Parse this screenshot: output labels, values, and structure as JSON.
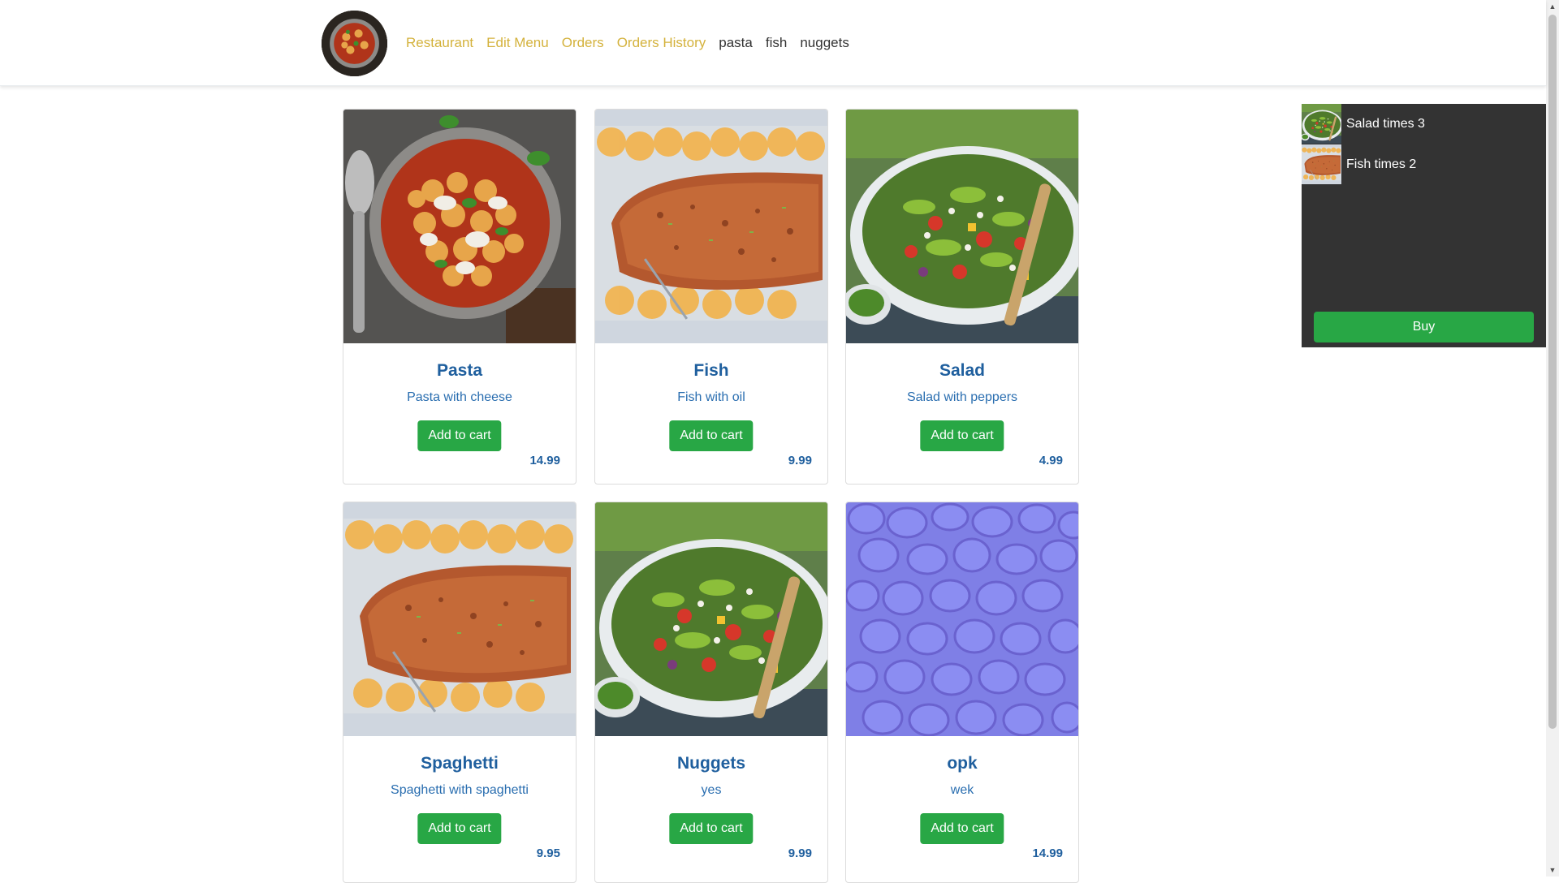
{
  "nav": {
    "logo_alt": "restaurant-logo",
    "links": [
      {
        "label": "Restaurant",
        "style": "accent"
      },
      {
        "label": "Edit Menu",
        "style": "accent"
      },
      {
        "label": "Orders",
        "style": "accent"
      },
      {
        "label": "Orders History",
        "style": "accent"
      },
      {
        "label": "pasta",
        "style": "dark"
      },
      {
        "label": "fish",
        "style": "dark"
      },
      {
        "label": "nuggets",
        "style": "dark"
      }
    ]
  },
  "products": [
    {
      "name": "Pasta",
      "description": "Pasta with cheese",
      "button": "Add to cart",
      "price": "14.99",
      "image": "pasta-photo"
    },
    {
      "name": "Fish",
      "description": "Fish with oil",
      "button": "Add to cart",
      "price": "9.99",
      "image": "salmon-photo"
    },
    {
      "name": "Salad",
      "description": "Salad with peppers",
      "button": "Add to cart",
      "price": "4.99",
      "image": "salad-photo"
    },
    {
      "name": "Spaghetti",
      "description": "Spaghetti with spaghetti",
      "button": "Add to cart",
      "price": "9.95",
      "image": "salmon-photo"
    },
    {
      "name": "Nuggets",
      "description": "yes",
      "button": "Add to cart",
      "price": "9.99",
      "image": "salad-photo"
    },
    {
      "name": "opk",
      "description": "wek",
      "button": "Add to cart",
      "price": "14.99",
      "image": "normal-map-texture"
    }
  ],
  "cart": {
    "items": [
      {
        "text": "Salad times 3",
        "image": "salad-photo"
      },
      {
        "text": "Fish times 2",
        "image": "salmon-photo"
      }
    ],
    "buy_label": "Buy"
  },
  "colors": {
    "accent_link": "#d4b23c",
    "button_green": "#28a745",
    "title_blue": "#1f5f9e",
    "cart_bg": "#333333"
  }
}
